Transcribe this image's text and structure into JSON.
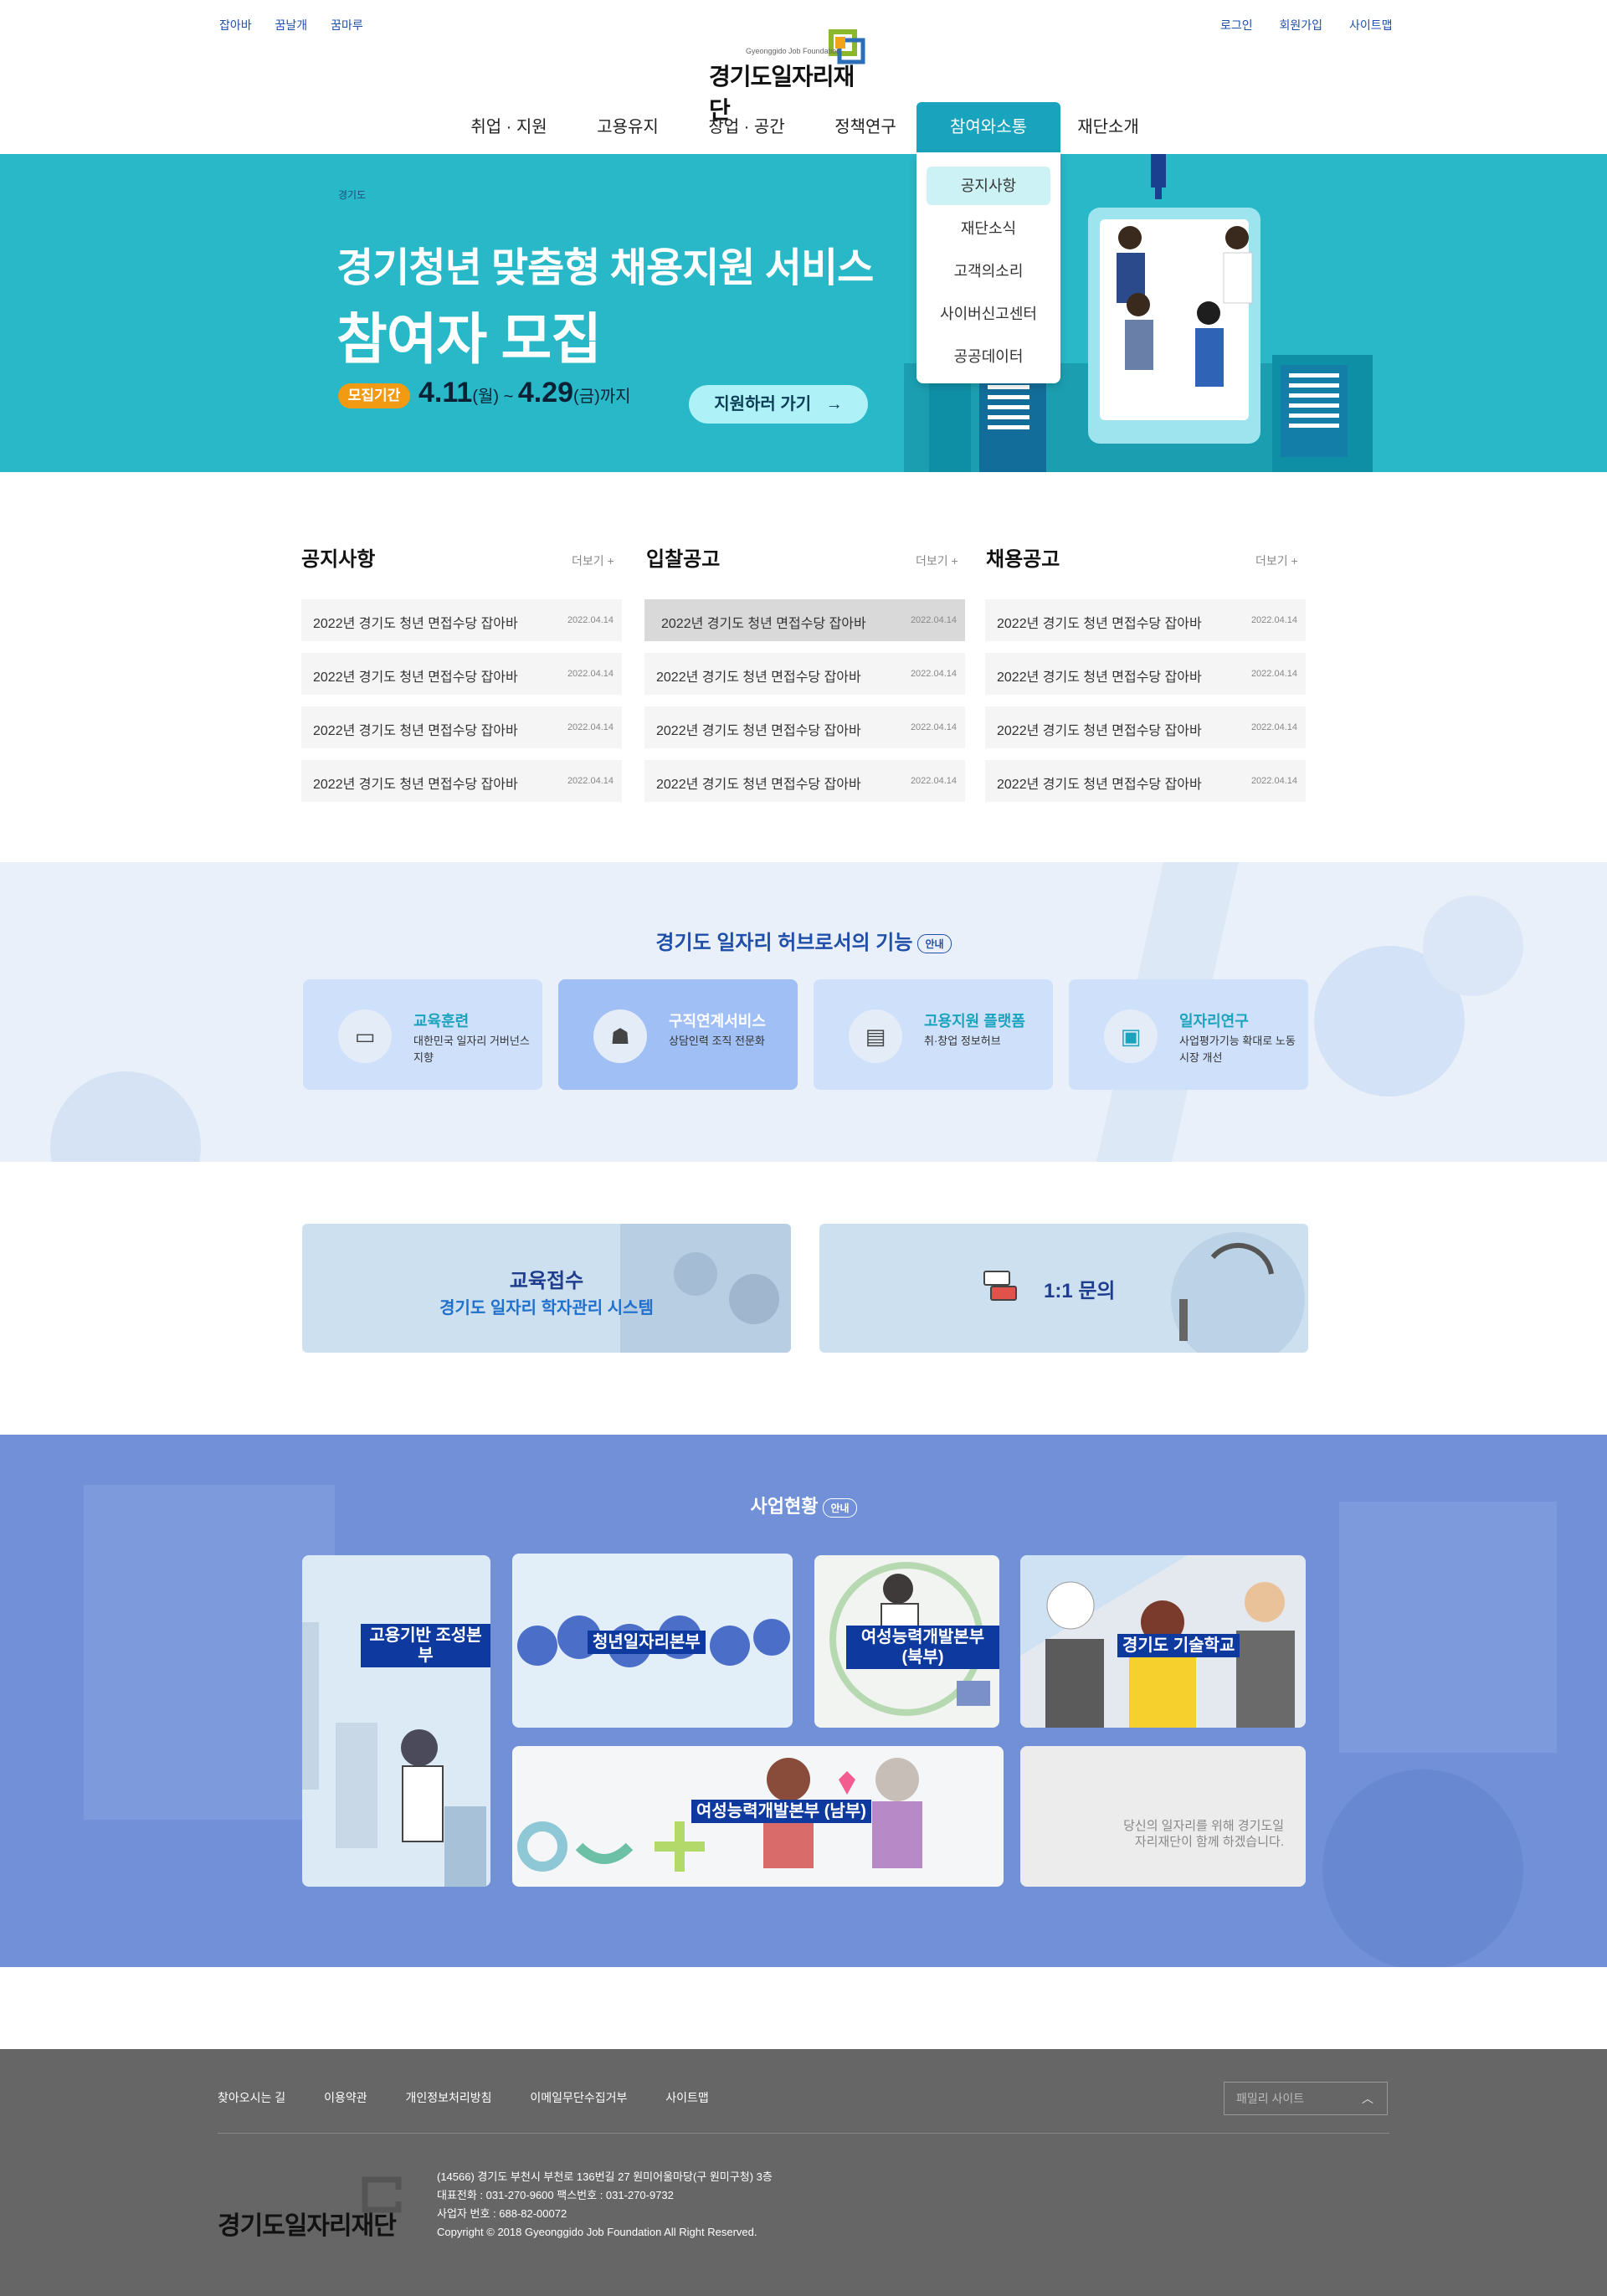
{
  "util_left": [
    "잡아바",
    "꿈날개",
    "꿈마루"
  ],
  "util_right": [
    "로그인",
    "회원가입",
    "사이트맵"
  ],
  "logo": {
    "sub": "Gyeonggido Job Foundation",
    "name": "경기도일자리재단"
  },
  "gnb": [
    "취업 · 지원",
    "고용유지",
    "창업 · 공간",
    "정책연구",
    "참여와소통",
    "재단소개"
  ],
  "dropdown": [
    "공지사항",
    "재단소식",
    "고객의소리",
    "사이버신고센터",
    "공공데이터"
  ],
  "banner": {
    "brand": "경기도",
    "title1": "경기청년 맞춤형 채용지원 서비스",
    "title2": "참여자 모집",
    "period_label": "모집기간",
    "date_start": "4.11",
    "day_start": "(월)",
    "sep": " ~ ",
    "date_end": "4.29",
    "day_end": "(금)",
    "until": "까지",
    "cta": "지원하러 가기"
  },
  "boards": [
    {
      "title": "공지사항",
      "more": "더보기 +",
      "items": [
        {
          "t": "2022년 경기도 청년 면접수당 잡아바",
          "d": "2022.04.14"
        },
        {
          "t": "2022년 경기도 청년 면접수당 잡아바",
          "d": "2022.04.14"
        },
        {
          "t": "2022년 경기도 청년 면접수당 잡아바",
          "d": "2022.04.14"
        },
        {
          "t": "2022년 경기도 청년 면접수당 잡아바",
          "d": "2022.04.14"
        }
      ]
    },
    {
      "title": "입찰공고",
      "more": "더보기 +",
      "items": [
        {
          "t": "2022년 경기도 청년 면접수당 잡아바",
          "d": "2022.04.14"
        },
        {
          "t": "2022년 경기도 청년 면접수당 잡아바",
          "d": "2022.04.14"
        },
        {
          "t": "2022년 경기도 청년 면접수당 잡아바",
          "d": "2022.04.14"
        },
        {
          "t": "2022년 경기도 청년 면접수당 잡아바",
          "d": "2022.04.14"
        }
      ]
    },
    {
      "title": "채용공고",
      "more": "더보기 +",
      "items": [
        {
          "t": "2022년 경기도 청년 면접수당 잡아바",
          "d": "2022.04.14"
        },
        {
          "t": "2022년 경기도 청년 면접수당 잡아바",
          "d": "2022.04.14"
        },
        {
          "t": "2022년 경기도 청년 면접수당 잡아바",
          "d": "2022.04.14"
        },
        {
          "t": "2022년 경기도 청년 면접수당 잡아바",
          "d": "2022.04.14"
        }
      ]
    }
  ],
  "features": {
    "title": "경기도 일자리 허브로서의 기능",
    "badge": "안내",
    "items": [
      {
        "title": "교육훈련",
        "desc": "대한민국 일자리 거버넌스 지향",
        "icon": "presentation-icon"
      },
      {
        "title": "구직연계서비스",
        "desc": "상담인력 조직 전문화",
        "icon": "counseling-icon"
      },
      {
        "title": "고용지원 플랫폼",
        "desc": "취·창업 정보허브",
        "icon": "document-icon"
      },
      {
        "title": "일자리연구",
        "desc": "사업평가기능 확대로 노동시장 개선",
        "icon": "briefcase-icon"
      }
    ]
  },
  "quick": {
    "edu_title": "교육접수",
    "edu_sub": "경기도 일자리 학자관리 시스템",
    "inquiry": "1:1 문의"
  },
  "business": {
    "title": "사업현황",
    "badge": "안내",
    "cards": [
      "고용기반 조성본부",
      "청년일자리본부",
      "여성능력개발본부 (북부)",
      "경기도 기술학교",
      "여성능력개발본부 (남부)"
    ],
    "slogan": "당신의 일자리를 위해 경기도일자리재단이 함께 하겠습니다."
  },
  "footer": {
    "links": [
      "찾아오시는 길",
      "이용약관",
      "개인정보처리방침",
      "이메일무단수집거부",
      "사이트맵"
    ],
    "family": "패밀리 사이트",
    "logo": "경기도일자리재단",
    "address": "(14566) 경기도 부천시 부천로 136번길 27 원미어울마당(구 원미구청) 3층",
    "phone": "대표전화 : 031-270-9600 팩스번호 : 031-270-9732",
    "bizno": "사업자 번호 : 688-82-00072",
    "copyright": "Copyright © 2018 Gyeonggido Job Foundation All Right Reserved."
  },
  "colors": {
    "primary": "#1aa3bd",
    "navy": "#1f4fa8",
    "banner": "#28b8c8",
    "footer": "#666666"
  }
}
